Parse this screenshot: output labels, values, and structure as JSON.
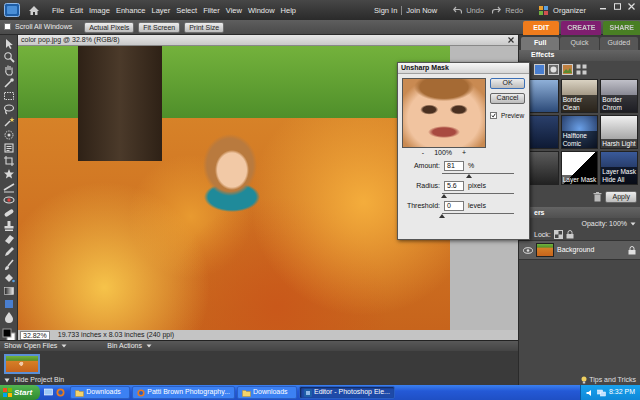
{
  "menubar": {
    "menu": [
      "File",
      "Edit",
      "Image",
      "Enhance",
      "Layer",
      "Select",
      "Filter",
      "View",
      "Window",
      "Help"
    ],
    "account": [
      "Sign In",
      "Join Now"
    ],
    "history": [
      "Undo",
      "Redo"
    ],
    "organizer": "Organizer"
  },
  "options_bar": {
    "scroll_all": {
      "label": "Scroll All Windows",
      "checked": false
    },
    "buttons": [
      "Actual Pixels",
      "Fit Screen",
      "Print Size"
    ]
  },
  "modes": [
    {
      "label": "EDIT",
      "selected": true,
      "color": "#f07c1c"
    },
    {
      "label": "CREATE",
      "selected": false,
      "color": "#a3268f"
    },
    {
      "label": "SHARE",
      "selected": false,
      "color": "#5da32e"
    }
  ],
  "document": {
    "title": "color pop.jpg @ 32.8% (RGB/8)",
    "zoom": "32.82%",
    "info": "19.733 inches x 8.03 inches (240 ppi)"
  },
  "dialog": {
    "title": "Unsharp Mask",
    "buttons": [
      "OK",
      "Cancel"
    ],
    "preview": {
      "label": "Preview",
      "checked": true
    },
    "zoom": {
      "out": "-",
      "value": "100%",
      "in": "+"
    },
    "fields": [
      {
        "label": "Amount:",
        "value": "81",
        "unit": "%",
        "level": 0.38
      },
      {
        "label": "Radius:",
        "value": "5.6",
        "unit": "pixels",
        "level": 0.03
      },
      {
        "label": "Threshold:",
        "value": "0",
        "unit": "levels",
        "level": 0
      }
    ]
  },
  "panel": {
    "tabs": [
      {
        "label": "Full",
        "selected": true
      },
      {
        "label": "Quick",
        "selected": false
      },
      {
        "label": "Guided",
        "selected": false
      }
    ],
    "effects_title": "Effects",
    "effects": [
      {
        "label": "Border Clean"
      },
      {
        "label": "Border Chrom"
      },
      {
        "label": "Halftone Comic"
      },
      {
        "label": "Harsh Light"
      },
      {
        "label": "Layer Mask"
      },
      {
        "label": "Layer Mask Hide All"
      }
    ],
    "apply": "Apply",
    "layers_title": "ers",
    "opacity": "Opacity: 100%",
    "lock": "Lock:",
    "layers": [
      {
        "name": "Background",
        "locked": true
      }
    ]
  },
  "bin": {
    "show": "Show Open Files",
    "actions": "Bin Actions",
    "hide": "Hide Project Bin",
    "files": [
      {
        "selected": true
      }
    ]
  },
  "tips": "Tips and Tricks",
  "taskbar": {
    "start": "Start",
    "items": [
      {
        "label": "Downloads",
        "selected": false
      },
      {
        "label": "Patti Brown Photography...",
        "selected": false
      },
      {
        "label": "Downloads",
        "selected": false
      },
      {
        "label": "Editor - Photoshop Ele...",
        "selected": true
      }
    ],
    "clock": "8:32 PM"
  }
}
